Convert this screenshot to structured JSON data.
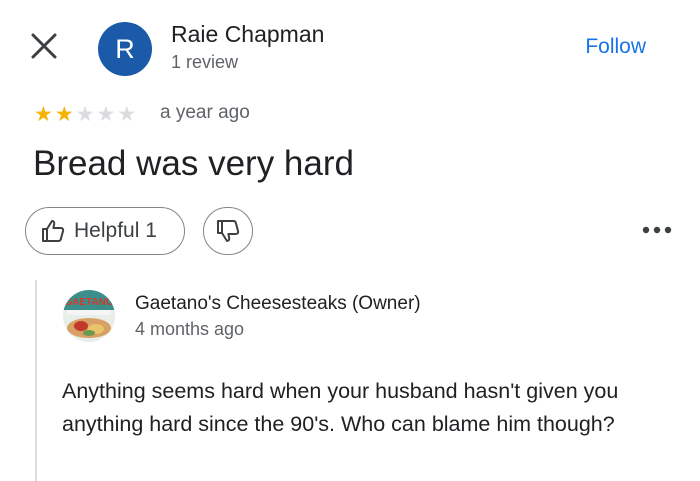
{
  "colors": {
    "avatar_bg": "#1a5aa8",
    "follow": "#1a73e8",
    "star_filled": "#f4b400",
    "star_empty": "#dadce0",
    "secondary_text": "#5f6368"
  },
  "header": {
    "close_icon": "close-icon",
    "avatar_initial": "R",
    "user_name": "Raie Chapman",
    "user_meta": "1 review",
    "follow_label": "Follow"
  },
  "review": {
    "rating": 2,
    "max_rating": 5,
    "date": "a year ago",
    "text": "Bread was very hard"
  },
  "actions": {
    "helpful_label": "Helpful 1",
    "helpful_icon": "thumbs-up-icon",
    "not_helpful_icon": "thumbs-down-icon",
    "more_icon": "more-horizontal-icon"
  },
  "owner_reply": {
    "logo_text": "GAETANO",
    "owner_name": "Gaetano's Cheesesteaks (Owner)",
    "date": "4 months ago",
    "text": "Anything seems hard when your husband hasn't given you anything hard since the 90's. Who can blame him though?"
  }
}
